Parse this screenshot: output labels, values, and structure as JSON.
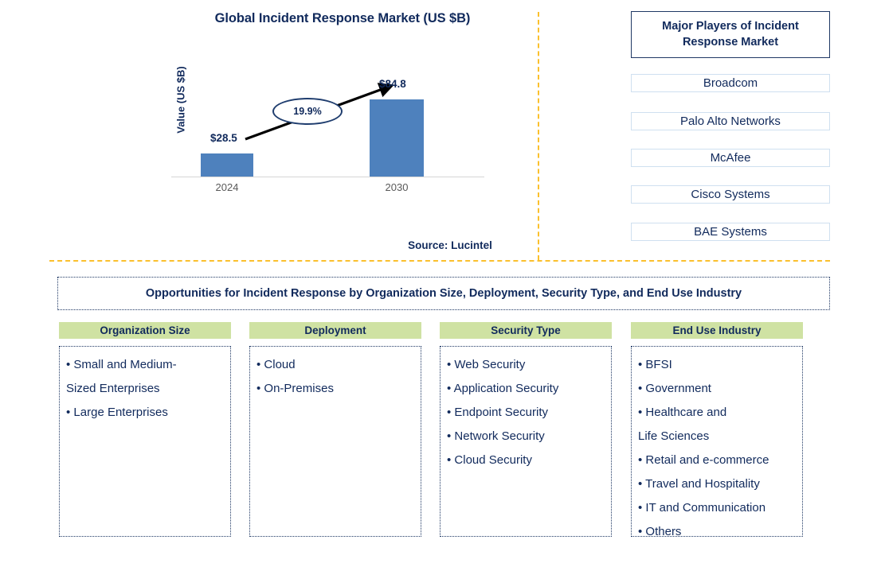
{
  "chart": {
    "title": "Global Incident Response Market (US $B)",
    "ylabel": "Value (US $B)",
    "cagr": "19.9%",
    "source": "Source: Lucintel",
    "value_2024": "$28.5",
    "value_2030": "$84.8",
    "tick_2024": "2024",
    "tick_2030": "2030"
  },
  "chart_data": {
    "type": "bar",
    "title": "Global Incident Response Market (US $B)",
    "categories": [
      "2024",
      "2030"
    ],
    "values": [
      28.5,
      84.8
    ],
    "data_labels": [
      "$28.5",
      "$84.8"
    ],
    "xlabel": "",
    "ylabel": "Value (US $B)",
    "ylim": [
      0,
      100
    ],
    "grid": false,
    "legend": "none",
    "annotations": [
      {
        "text": "19.9%",
        "kind": "cagr-bubble-with-arrow",
        "from": "2024",
        "to": "2030"
      }
    ],
    "series": [
      {
        "name": "Value (US $B)",
        "values": [
          28.5,
          84.8
        ],
        "color": "#4e81bd"
      }
    ],
    "source": "Source: Lucintel"
  },
  "players": {
    "header": "Major Players of Incident\nResponse Market",
    "header_line1": "Major Players of Incident",
    "header_line2": "Response Market",
    "items": [
      "Broadcom",
      "Palo Alto Networks",
      "McAfee",
      "Cisco Systems",
      "BAE Systems"
    ]
  },
  "opportunities": {
    "banner": "Opportunities for Incident Response by Organization Size, Deployment, Security Type, and End Use Industry",
    "columns": [
      {
        "header": "Organization Size",
        "items": [
          "Small and Medium-\nSized Enterprises",
          "Large Enterprises"
        ]
      },
      {
        "header": "Deployment",
        "items": [
          "Cloud",
          "On-Premises"
        ]
      },
      {
        "header": "Security Type",
        "items": [
          "Web Security",
          "Application Security",
          "Endpoint Security",
          "Network Security",
          "Cloud Security"
        ]
      },
      {
        "header": "End Use Industry",
        "items": [
          "BFSI",
          "Government",
          "Healthcare and\nLife Sciences",
          "Retail and e-commerce",
          "Travel and Hospitality",
          "IT and Communication",
          "Others"
        ]
      }
    ]
  },
  "colors": {
    "bar": "#4e81bd",
    "navy": "#112a5c",
    "header_green": "#cfe2a3",
    "divider_orange": "#fbc02d"
  }
}
